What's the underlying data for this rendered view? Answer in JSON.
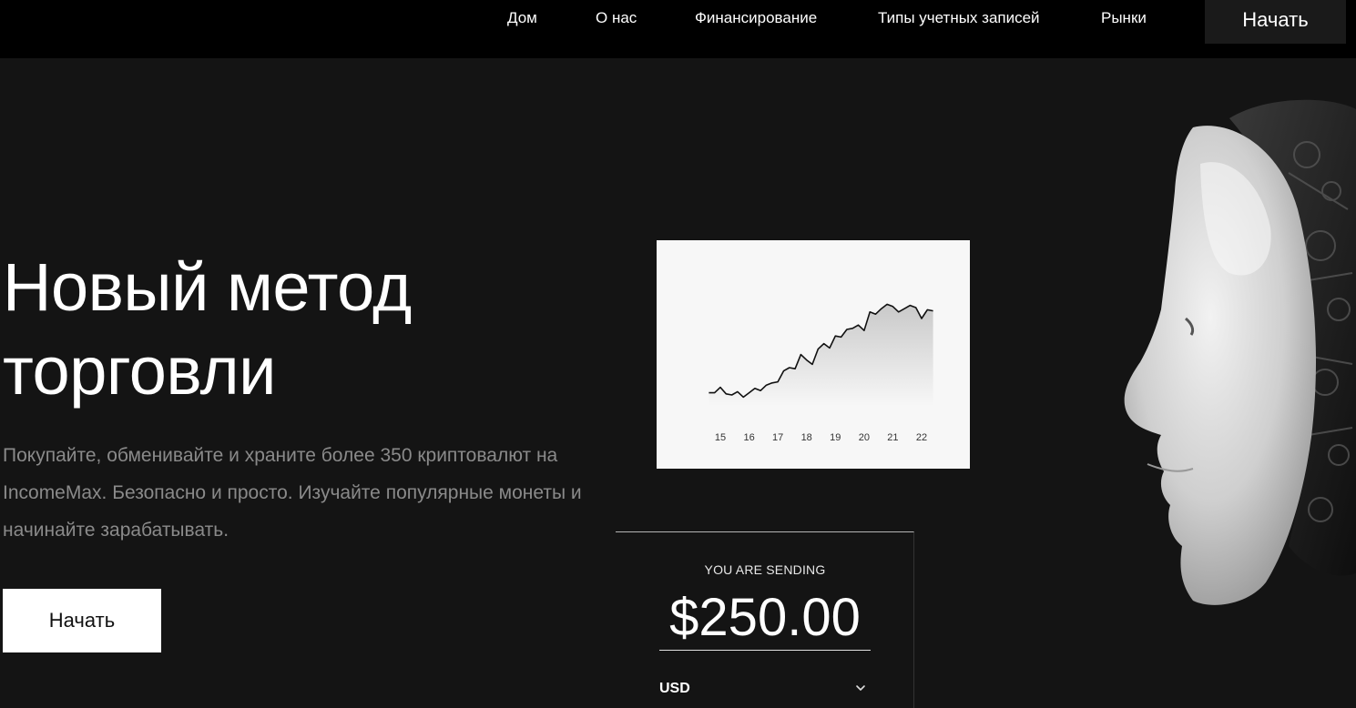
{
  "nav": {
    "items": [
      {
        "label": "Дом"
      },
      {
        "label": "О нас"
      },
      {
        "label": "Финансирование"
      },
      {
        "label": "Типы учетных записей"
      },
      {
        "label": "Рынки"
      }
    ],
    "cta_label": "Начать"
  },
  "hero": {
    "title_line1": "Новый метод",
    "title_line2": "торговли",
    "description": "Покупайте, обменивайте и храните более 350 криптовалют на IncomeMax. Безопасно и просто. Изучайте популярные монеты и начинайте зарабатывать.",
    "button_label": "Начать"
  },
  "chart_data": {
    "type": "area",
    "title": "",
    "xlabel": "",
    "ylabel": "",
    "x_ticks": [
      "15",
      "16",
      "17",
      "18",
      "19",
      "20",
      "21",
      "22"
    ],
    "x": [
      14.6,
      14.8,
      15.0,
      15.2,
      15.4,
      15.6,
      15.8,
      16.0,
      16.2,
      16.4,
      16.6,
      16.8,
      17.0,
      17.2,
      17.4,
      17.6,
      17.8,
      18.0,
      18.2,
      18.4,
      18.6,
      18.8,
      19.0,
      19.2,
      19.4,
      19.6,
      19.8,
      20.0,
      20.2,
      20.4,
      20.6,
      20.8,
      21.0,
      21.2,
      21.4,
      21.6,
      21.8,
      22.0,
      22.2,
      22.4
    ],
    "values": [
      12,
      12,
      17,
      11,
      10,
      13,
      8,
      12,
      16,
      14,
      19,
      21,
      22,
      32,
      35,
      34,
      47,
      42,
      38,
      52,
      57,
      53,
      64,
      63,
      70,
      71,
      74,
      69,
      86,
      84,
      89,
      93,
      91,
      86,
      89,
      92,
      90,
      80,
      88,
      87
    ],
    "color": "#111111",
    "fill_gradient": [
      "#c9c9c9",
      "#f7f7f7"
    ]
  },
  "send": {
    "label": "YOU ARE SENDING",
    "amount": "$250.00",
    "currency": "USD"
  },
  "colors": {
    "background": "#141414",
    "topbar": "#000000",
    "muted_text": "#8a8a8a"
  }
}
